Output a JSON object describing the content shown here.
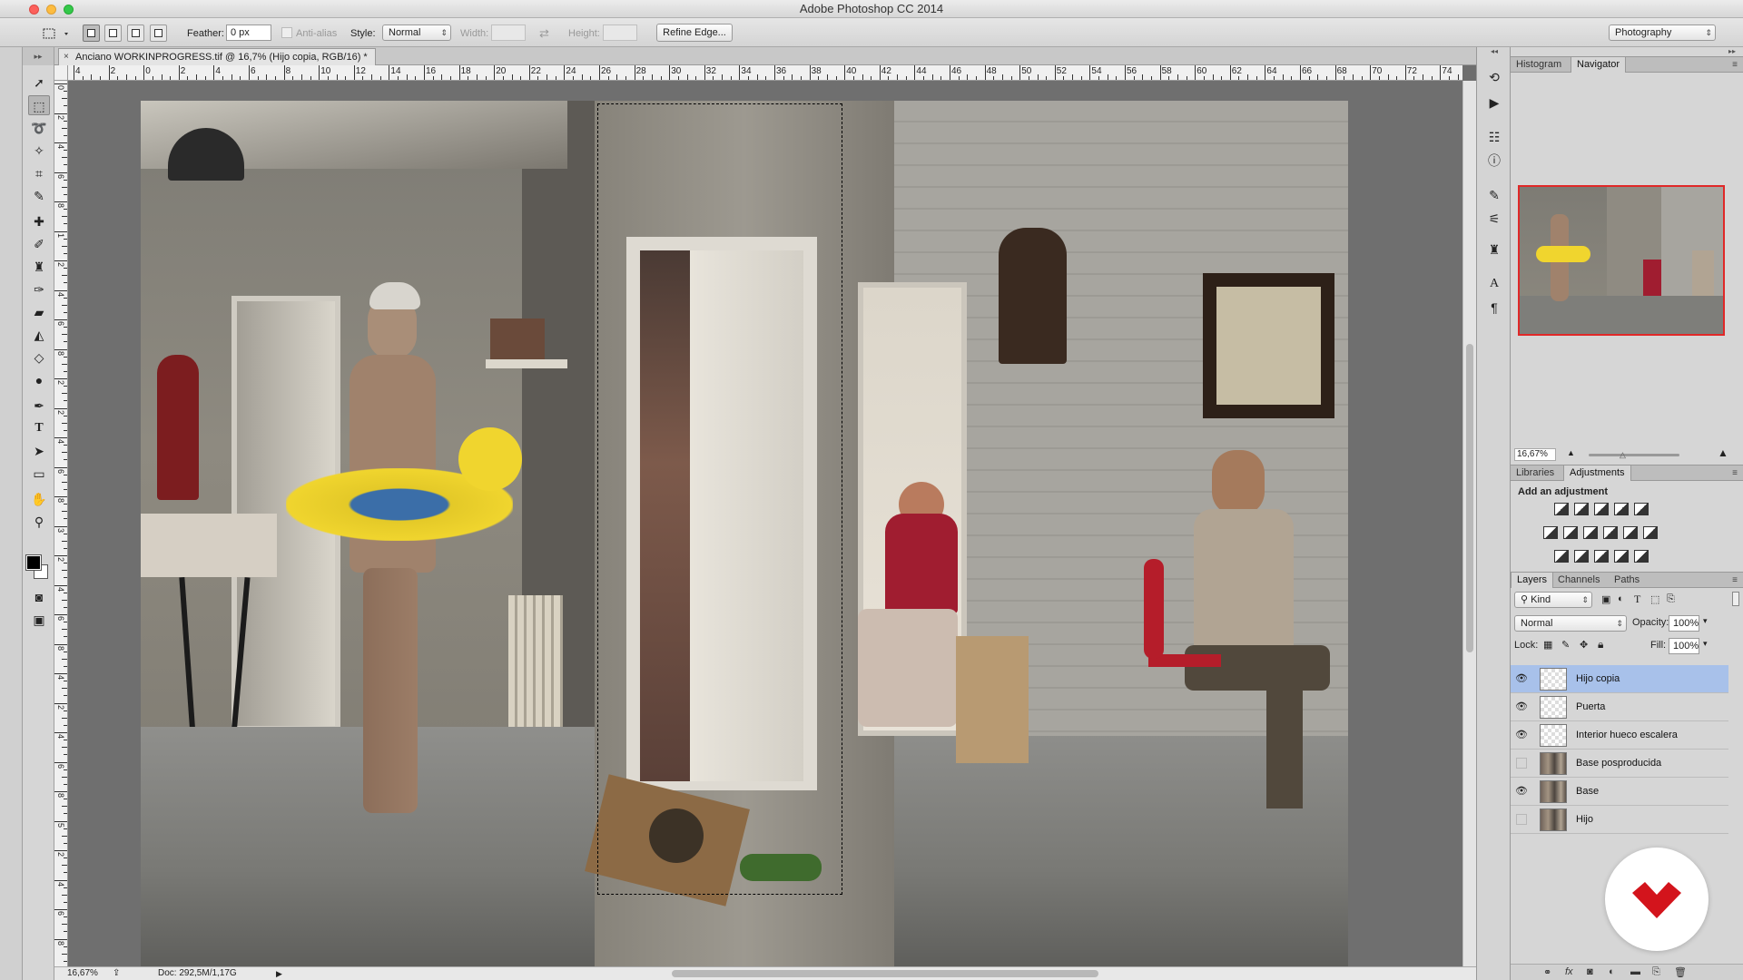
{
  "window": {
    "title": "Adobe Photoshop CC 2014"
  },
  "options_bar": {
    "feather_label": "Feather:",
    "feather_value": "0 px",
    "antialias_label": "Anti-alias",
    "style_label": "Style:",
    "style_value": "Normal",
    "width_label": "Width:",
    "height_label": "Height:",
    "refine_edge_label": "Refine Edge...",
    "workspace_value": "Photography"
  },
  "document": {
    "tab_title": "Anciano WORKINPROGRESS.tif @ 16,7% (Hijo copia, RGB/16) *",
    "close_glyph": "×"
  },
  "rulers": {
    "top_labels": [
      "4",
      "2",
      "0",
      "2",
      "4",
      "6",
      "8",
      "10",
      "12",
      "14",
      "16",
      "18",
      "20",
      "22",
      "24",
      "26",
      "28",
      "30",
      "32",
      "34",
      "36",
      "38",
      "40",
      "42",
      "44",
      "46",
      "48",
      "50",
      "52",
      "54",
      "56",
      "58",
      "60",
      "62",
      "64",
      "66",
      "68",
      "70",
      "72",
      "74"
    ],
    "left_labels": [
      "0",
      "2",
      "4",
      "6",
      "8",
      "1",
      "2",
      "4",
      "6",
      "8",
      "2",
      "2",
      "4",
      "6",
      "8",
      "3",
      "2",
      "4",
      "6",
      "8",
      "4",
      "2",
      "4",
      "6",
      "8",
      "5",
      "2",
      "4",
      "6",
      "8"
    ]
  },
  "status_bar": {
    "zoom": "16,67%",
    "doc_info": "Doc: 292,5M/1,17G"
  },
  "navigator": {
    "tabs": [
      "Histogram",
      "Navigator"
    ],
    "active_tab": "Navigator",
    "zoom": "16,67%"
  },
  "adjustments": {
    "tabs": [
      "Libraries",
      "Adjustments"
    ],
    "active_tab": "Adjustments",
    "heading": "Add an adjustment"
  },
  "layers_panel": {
    "tabs": [
      "Layers",
      "Channels",
      "Paths"
    ],
    "active_tab": "Layers",
    "filter_value": "Kind",
    "blend_mode": "Normal",
    "opacity_label": "Opacity:",
    "opacity_value": "100%",
    "lock_label": "Lock:",
    "fill_label": "Fill:",
    "fill_value": "100%",
    "layers": [
      {
        "name": "Hijo copia",
        "visible": true,
        "selected": true,
        "thumb": "transparent"
      },
      {
        "name": "Puerta",
        "visible": true,
        "selected": false,
        "thumb": "transparent"
      },
      {
        "name": "Interior hueco escalera",
        "visible": true,
        "selected": false,
        "thumb": "transparent"
      },
      {
        "name": "Base posproducida",
        "visible": false,
        "selected": false,
        "thumb": "photo"
      },
      {
        "name": "Base",
        "visible": true,
        "selected": false,
        "thumb": "photo"
      },
      {
        "name": "Hijo",
        "visible": false,
        "selected": false,
        "thumb": "photo"
      }
    ]
  },
  "colors": {
    "selection_highlight": "#a8c1ea",
    "navigator_frame": "#e02828",
    "brand_logo": "#d3141c"
  }
}
